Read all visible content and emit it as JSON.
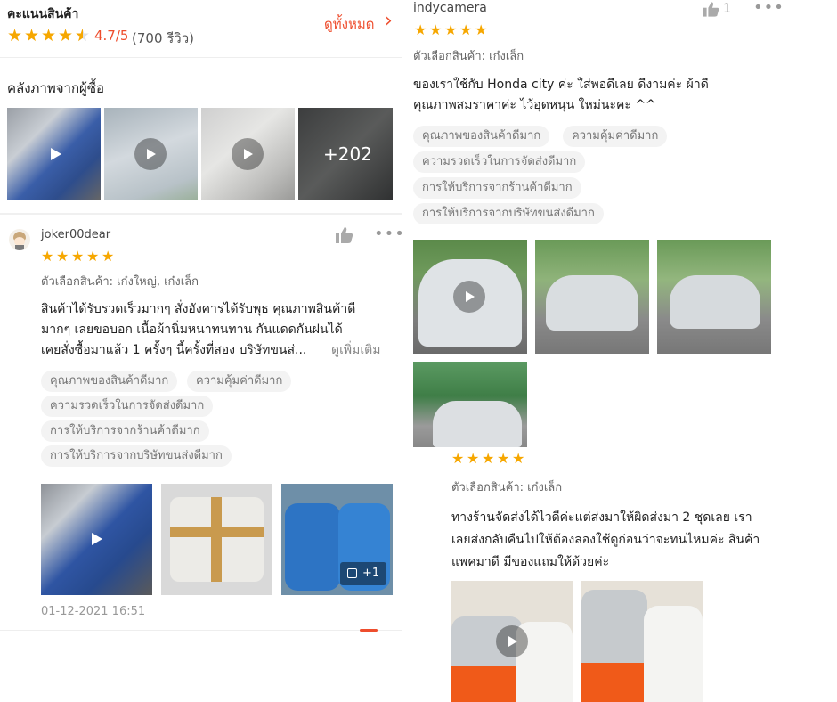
{
  "left": {
    "rating_header": {
      "title": "คะแนนสินค้า",
      "score": "4.7/5",
      "count": "(700 รีวิว)",
      "see_all": "ดูทั้งหมด",
      "see_all_arrow": "›"
    },
    "gallery": {
      "title": "คลังภาพจากผู้ซื้อ",
      "more_label": "+202"
    },
    "review": {
      "username": "joker00dear",
      "variation": "ตัวเลือกสินค้า: เก๋งใหญ่, เก๋งเล็ก",
      "text_lines": [
        "สินค้าได้รับรวดเร็วมากๆ สั่งอังคารได้รับพุธ คุณภาพสินค้าดี",
        "มากๆ เลยขอบอก เนื้อผ้านิ่มหนาทนทาน กันแดดกันฝนได้",
        "เคยสั่งซื้อมาแล้ว 1 ครั้งๆ นี้ครั้งที่สอง บริษัทขนส่..."
      ],
      "see_more": "ดูเพิ่มเติม",
      "tags": [
        "คุณภาพของสินค้าดีมาก",
        "ความคุ้มค่าดีมาก",
        "ความรวดเร็วในการจัดส่งดีมาก",
        "การให้บริการจากร้านค้าดีมาก",
        "การให้บริการจากบริษัทขนส่งดีมาก"
      ],
      "photo_more": "+1",
      "date": "01-12-2021 16:51"
    }
  },
  "right": {
    "review1": {
      "username": "indycamera",
      "like_count": "1",
      "variation": "ตัวเลือกสินค้า: เก๋งเล็ก",
      "text_lines": [
        "ของเราใช้กับ Honda city ค่ะ ใส่พอดีเลย ดีงามค่ะ ผ้าดี",
        "คุณภาพสมราคาค่ะ ไว้อุดหนุน ใหม่นะคะ ^^"
      ],
      "tags": [
        "คุณภาพของสินค้าดีมาก",
        "ความคุ้มค่าดีมาก",
        "ความรวดเร็วในการจัดส่งดีมาก",
        "การให้บริการจากร้านค้าดีมาก",
        "การให้บริการจากบริษัทขนส่งดีมาก"
      ]
    },
    "review2": {
      "variation": "ตัวเลือกสินค้า: เก๋งเล็ก",
      "text_lines": [
        "ทางร้านจัดส่งได้ไวดีค่ะแต่ส่งมาให้ผิดส่งมา 2 ชุดเลย เรา",
        "เลยส่งกลับคืนไปให้ต้องลองใช้ดูก่อนว่าจะทนไหมค่ะ สินค้า",
        "แพคมาดี มีของแถมให้ด้วยค่ะ"
      ]
    }
  },
  "colors": {
    "accent": "#ee4d2d",
    "star": "#f6a700",
    "tag_bg": "#f3f3f3",
    "muted": "#888888"
  },
  "icons": [
    "star-icon",
    "half-star-icon",
    "chevron-right-icon",
    "play-icon",
    "thumbs-up-icon",
    "more-dots-icon",
    "image-icon",
    "avatar"
  ]
}
